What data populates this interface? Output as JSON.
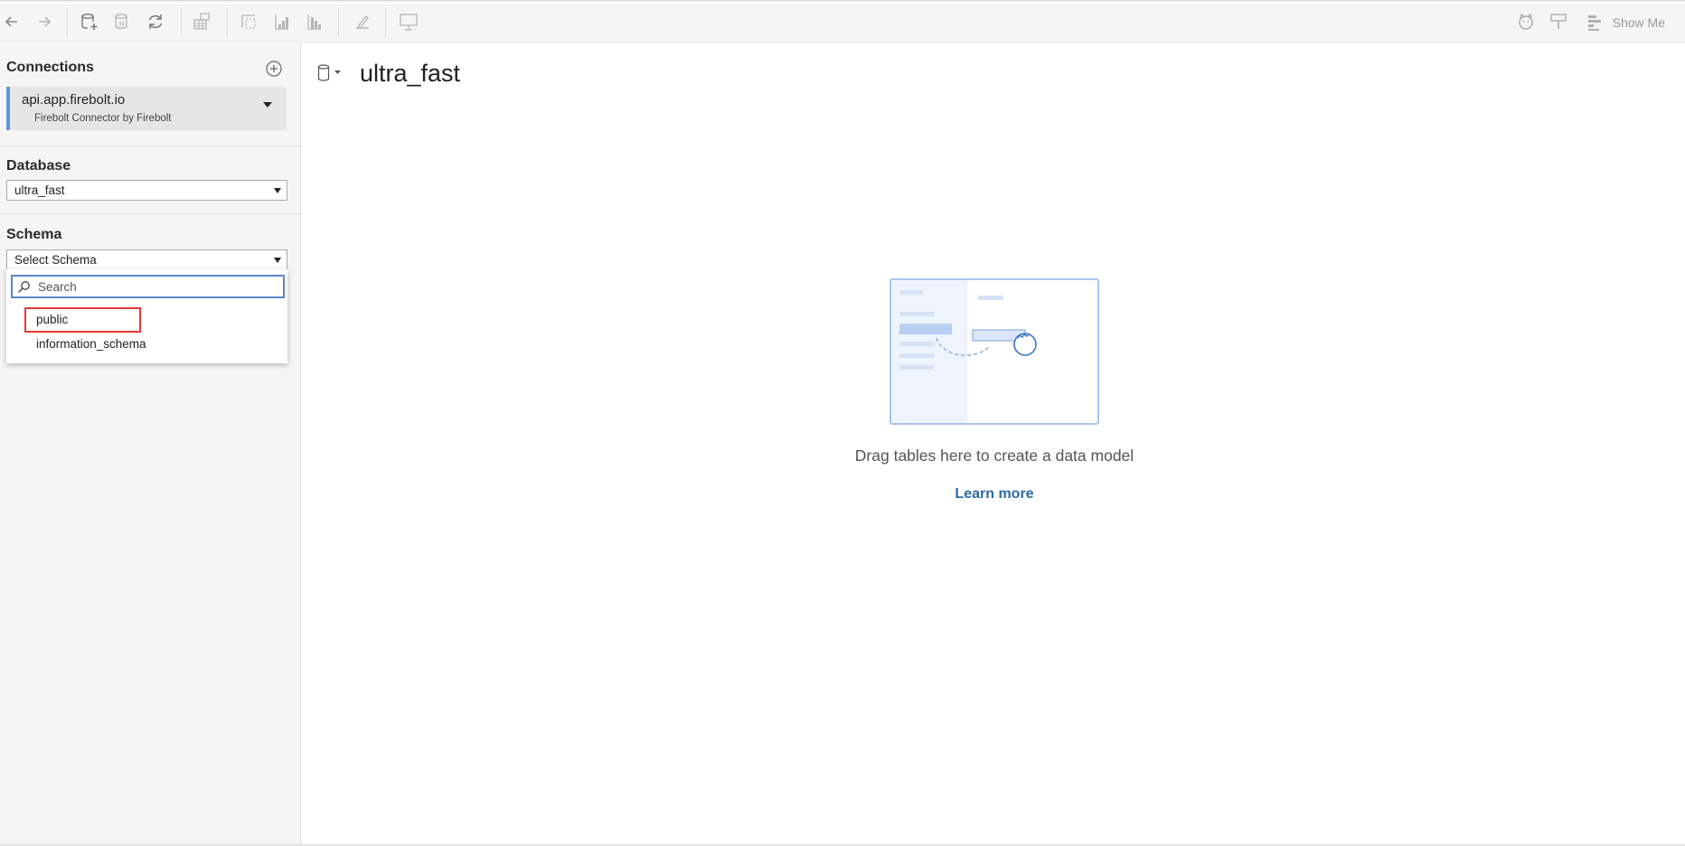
{
  "toolbar": {
    "show_me_label": "Show Me",
    "icons": [
      "back-icon",
      "forward-icon",
      "new-data-source-icon",
      "pause-updates-icon",
      "refresh-icon",
      "new-worksheet-icon",
      "swap-icon",
      "sort-ascending-icon",
      "sort-descending-icon",
      "highlight-icon",
      "presentation-icon",
      "cat-icon",
      "tooltip-icon",
      "show-me-icon"
    ]
  },
  "sidebar": {
    "connections_title": "Connections",
    "connection": {
      "name": "api.app.firebolt.io",
      "subtitle": "Firebolt Connector by Firebolt"
    },
    "database": {
      "title": "Database",
      "selected": "ultra_fast"
    },
    "schema": {
      "title": "Schema",
      "selected": "Select Schema",
      "search_placeholder": "Search",
      "options": [
        "public",
        "information_schema"
      ]
    }
  },
  "main": {
    "datasource_title": "ultra_fast",
    "empty_message": "Drag tables here to create a data model",
    "learn_more": "Learn more"
  },
  "colors": {
    "accent": "#5a86c8",
    "connection_bar": "#5b9ad5",
    "highlight": "#e53935",
    "link": "#2d6aa3"
  }
}
